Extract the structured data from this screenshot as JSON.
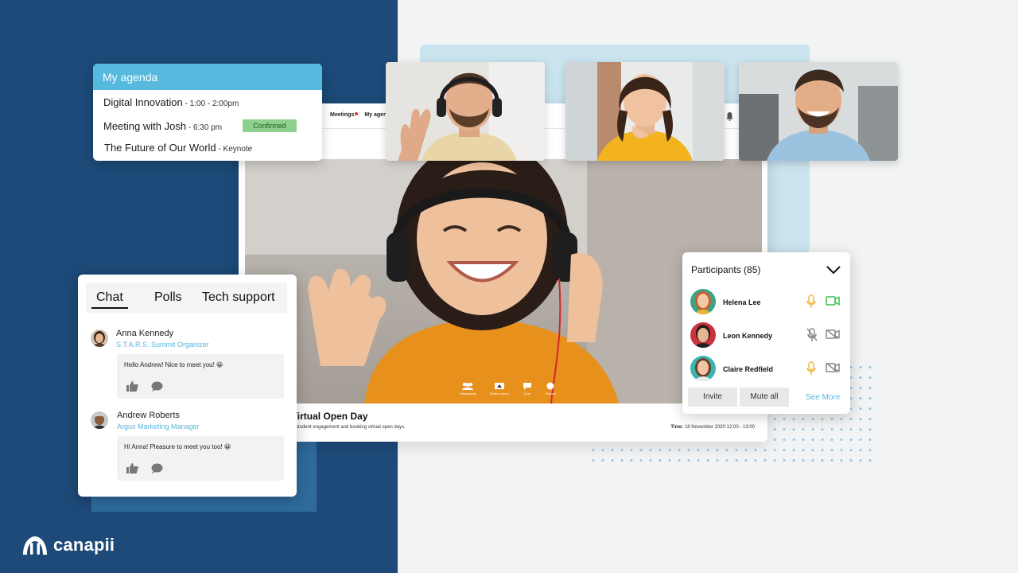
{
  "colors": {
    "navy": "#1d4a78",
    "sky": "#58b9df",
    "confirmed_bg": "#8ed08e",
    "link": "#5ab5dc",
    "mic_on": "#f2b93b",
    "cam_on": "#3fbf57"
  },
  "app": {
    "nav": {
      "meetings": "Meetings",
      "my_agenda": "My agenda"
    },
    "bell_icon": "bell-icon",
    "controls": [
      {
        "label": "Participants",
        "icon": "people-icon"
      },
      {
        "label": "Share screen",
        "icon": "screen-icon"
      },
      {
        "label": "Chat",
        "icon": "chat-icon"
      },
      {
        "label": "Record",
        "icon": "record-icon"
      }
    ],
    "event": {
      "title": "Virtual Open Day",
      "description": "student engagement and booking virtual open days.",
      "time_label": "Time:",
      "time_value": "18 November 2020 12:00 - 13:00"
    }
  },
  "agenda": {
    "title": "My agenda",
    "items": [
      {
        "title": "Digital Innovation",
        "detail": " - 1:00 - 2:00pm"
      },
      {
        "title": "Meeting with Josh",
        "detail": " - 6:30 pm",
        "badge": "Confirmed"
      },
      {
        "title": "The Future of Our World",
        "detail": " - Keynote"
      }
    ]
  },
  "chat": {
    "tabs": [
      "Chat",
      "Polls",
      "Tech support"
    ],
    "active_tab": "Chat",
    "messages": [
      {
        "name": "Anna Kennedy",
        "role": "S.T.A.R.S. Summit Organizer",
        "text": "Hello Andrew! Nice to meet you! 😀"
      },
      {
        "name": "Andrew Roberts",
        "role": "Argus Marketing Manager",
        "text": "Hi Anna! Pleasure to meet you too! 😀"
      }
    ]
  },
  "participants": {
    "title": "Participants (85)",
    "people": [
      {
        "name": "Helena Lee",
        "mic": "on",
        "cam": "on"
      },
      {
        "name": "Leon Kennedy",
        "mic": "off",
        "cam": "off"
      },
      {
        "name": "Claire Redfield",
        "mic": "on",
        "cam": "off"
      }
    ],
    "invite": "Invite",
    "mute_all": "Mute all",
    "see_more": "See More"
  },
  "brand": {
    "name": "canapii"
  }
}
